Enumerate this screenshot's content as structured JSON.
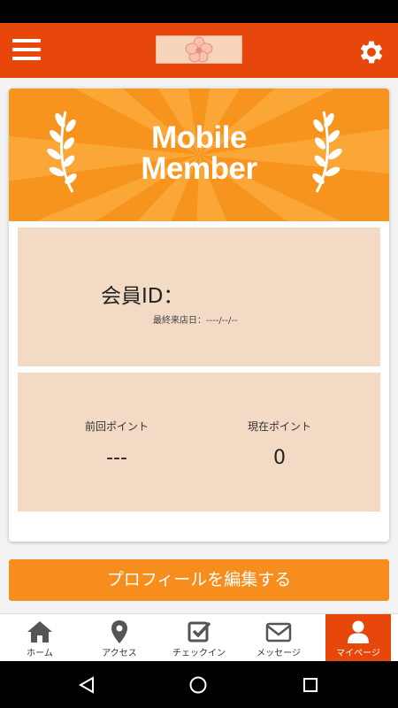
{
  "banner": {
    "title_line1": "Mobile",
    "title_line2": "Member"
  },
  "member": {
    "id_label": "会員ID：",
    "last_visit": "最終来店日：----/--/--"
  },
  "points": {
    "previous_label": "前回ポイント",
    "previous_value": "---",
    "current_label": "現在ポイント",
    "current_value": "0"
  },
  "edit_profile_label": "プロフィールを編集する",
  "tabs": [
    {
      "label": "ホーム",
      "icon": "home-icon"
    },
    {
      "label": "アクセス",
      "icon": "location-pin-icon"
    },
    {
      "label": "チェックイン",
      "icon": "checkbox-icon"
    },
    {
      "label": "メッセージ",
      "icon": "envelope-icon"
    },
    {
      "label": "マイページ",
      "icon": "user-icon",
      "active": true
    }
  ],
  "colors": {
    "header": "#e8470c",
    "accent": "#f68d1d",
    "panel": "#f3dac4"
  }
}
